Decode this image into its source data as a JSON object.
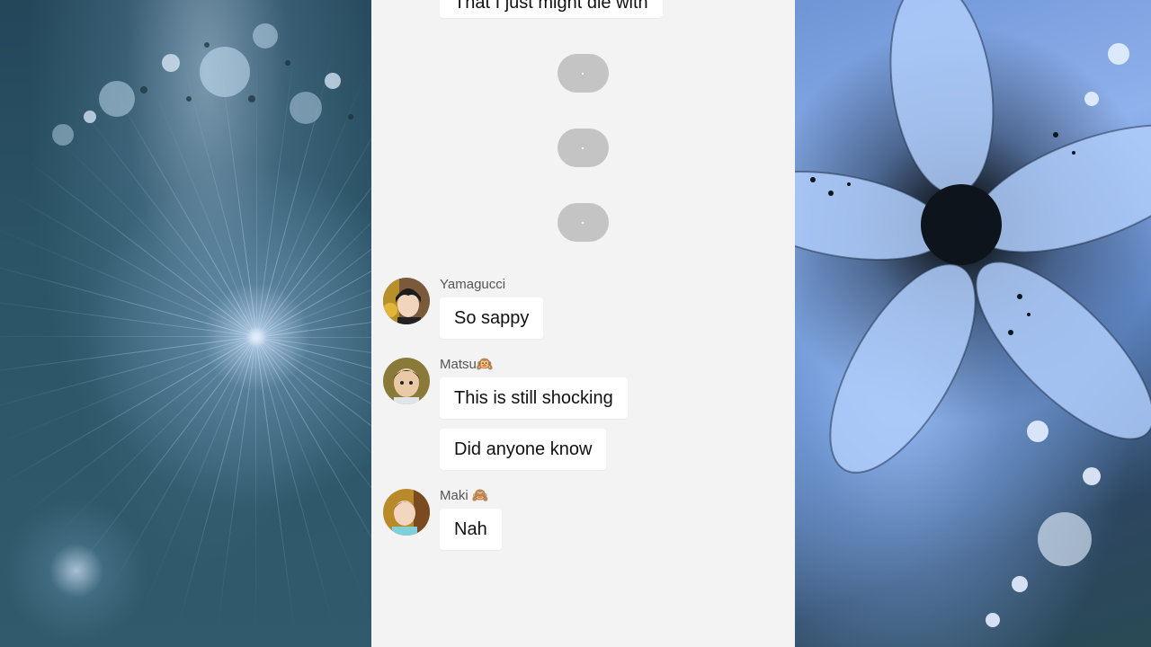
{
  "chat": {
    "top_partial_message": "That I just might die with",
    "typing_indicators": [
      ".",
      ".",
      "."
    ],
    "groups": [
      {
        "sender": "Yamagucci",
        "avatar": "yamaguchi-avatar",
        "messages": [
          "So sappy"
        ]
      },
      {
        "sender": "Matsu🙉",
        "avatar": "matsu-avatar",
        "messages": [
          "This is still shocking",
          "Did anyone know"
        ]
      },
      {
        "sender": "Maki 🙈",
        "avatar": "maki-avatar",
        "messages": [
          "Nah"
        ]
      }
    ]
  },
  "colors": {
    "panel_background": "#f3f3f3",
    "bubble_background": "#ffffff",
    "typing_bubble": "#c4c4c4"
  }
}
